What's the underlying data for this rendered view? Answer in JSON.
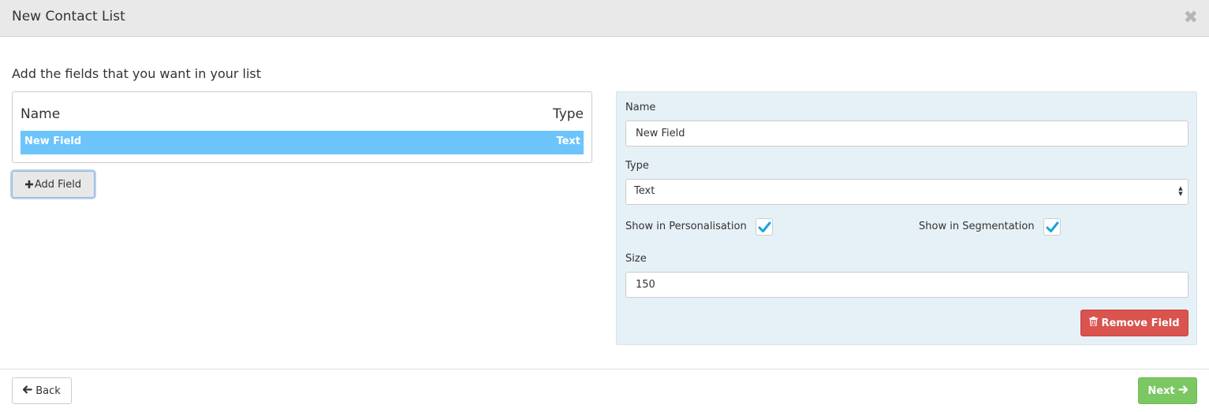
{
  "dialog": {
    "title": "New Contact List",
    "close_glyph": "✖"
  },
  "instruction": "Add the fields that you want in your list",
  "fields_table": {
    "header_name": "Name",
    "header_type": "Type",
    "rows": [
      {
        "name": "New Field",
        "type": "Text",
        "selected": true
      }
    ]
  },
  "add_field_button": {
    "icon": "plus-icon",
    "label": "Add Field"
  },
  "field_details": {
    "name_label": "Name",
    "name_value": "New Field",
    "type_label": "Type",
    "type_value": "Text",
    "personalisation_label": "Show in Personalisation",
    "personalisation_checked": true,
    "segmentation_label": "Show in Segmentation",
    "segmentation_checked": true,
    "size_label": "Size",
    "size_value": "150",
    "check_color": "#1aa1e0",
    "remove_button": {
      "icon": "trash-icon",
      "label": "Remove Field",
      "color": "#d9534f"
    }
  },
  "footer": {
    "back_button": {
      "icon": "arrow-left-icon",
      "label": "Back"
    },
    "next_button": {
      "icon": "arrow-right-icon",
      "label": "Next",
      "color": "#7bc862"
    }
  }
}
